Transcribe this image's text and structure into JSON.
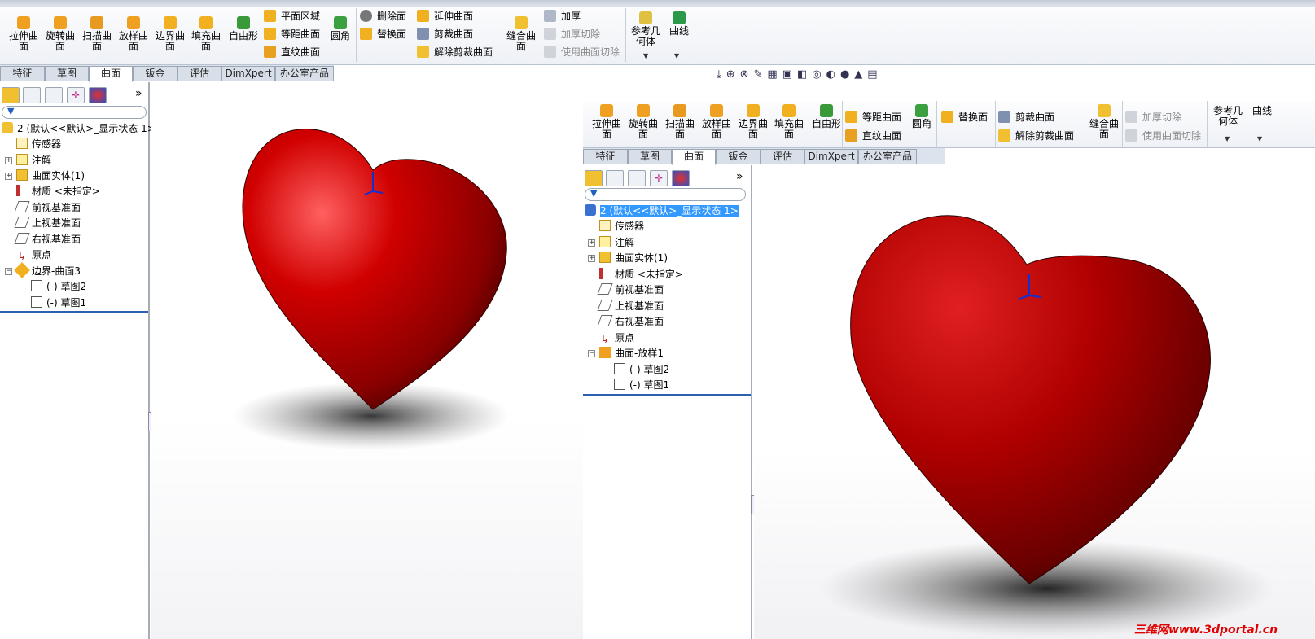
{
  "ribbon": {
    "big_buttons": [
      "拉伸曲面",
      "旋转曲面",
      "扫描曲面",
      "放样曲面",
      "边界曲面",
      "填充曲面",
      "自由形"
    ],
    "col1": [
      "平面区域",
      "等距曲面",
      "直纹曲面"
    ],
    "fillet": "圆角",
    "col2": [
      "删除面",
      "替换面"
    ],
    "col3": [
      "延伸曲面",
      "剪裁曲面",
      "解除剪裁曲面"
    ],
    "knit": "缝合曲面",
    "col4": [
      "加厚",
      "加厚切除",
      "使用曲面切除"
    ],
    "ref_geometry": "参考几何体",
    "curves": "曲线"
  },
  "tabs": [
    "特征",
    "草图",
    "曲面",
    "钣金",
    "评估",
    "DimXpert",
    "办公室产品"
  ],
  "active_tab": "曲面",
  "tree_left": {
    "root": "2 (默认<<默认>_显示状态 1>",
    "items": [
      "传感器",
      "注解",
      "曲面实体(1)",
      "材质 <未指定>",
      "前视基准面",
      "上视基准面",
      "右视基准面",
      "原点"
    ],
    "feature": "边界-曲面3",
    "sketches": [
      "(-) 草图2",
      "(-) 草图1"
    ]
  },
  "tree_right": {
    "root": "2 (默认<<默认>_显示状态 1>",
    "items": [
      "传感器",
      "注解",
      "曲面实体(1)",
      "材质 <未指定>",
      "前视基准面",
      "上视基准面",
      "右视基准面",
      "原点"
    ],
    "feature": "曲面-放样1",
    "sketches": [
      "(-) 草图2",
      "(-) 草图1"
    ]
  },
  "collapse_arrow": "»",
  "watermark": "三维网www.3dportal.cn",
  "colors": {
    "heart": "#c00000",
    "selection": "#3399ff",
    "ribbon": "#eef1f6"
  }
}
